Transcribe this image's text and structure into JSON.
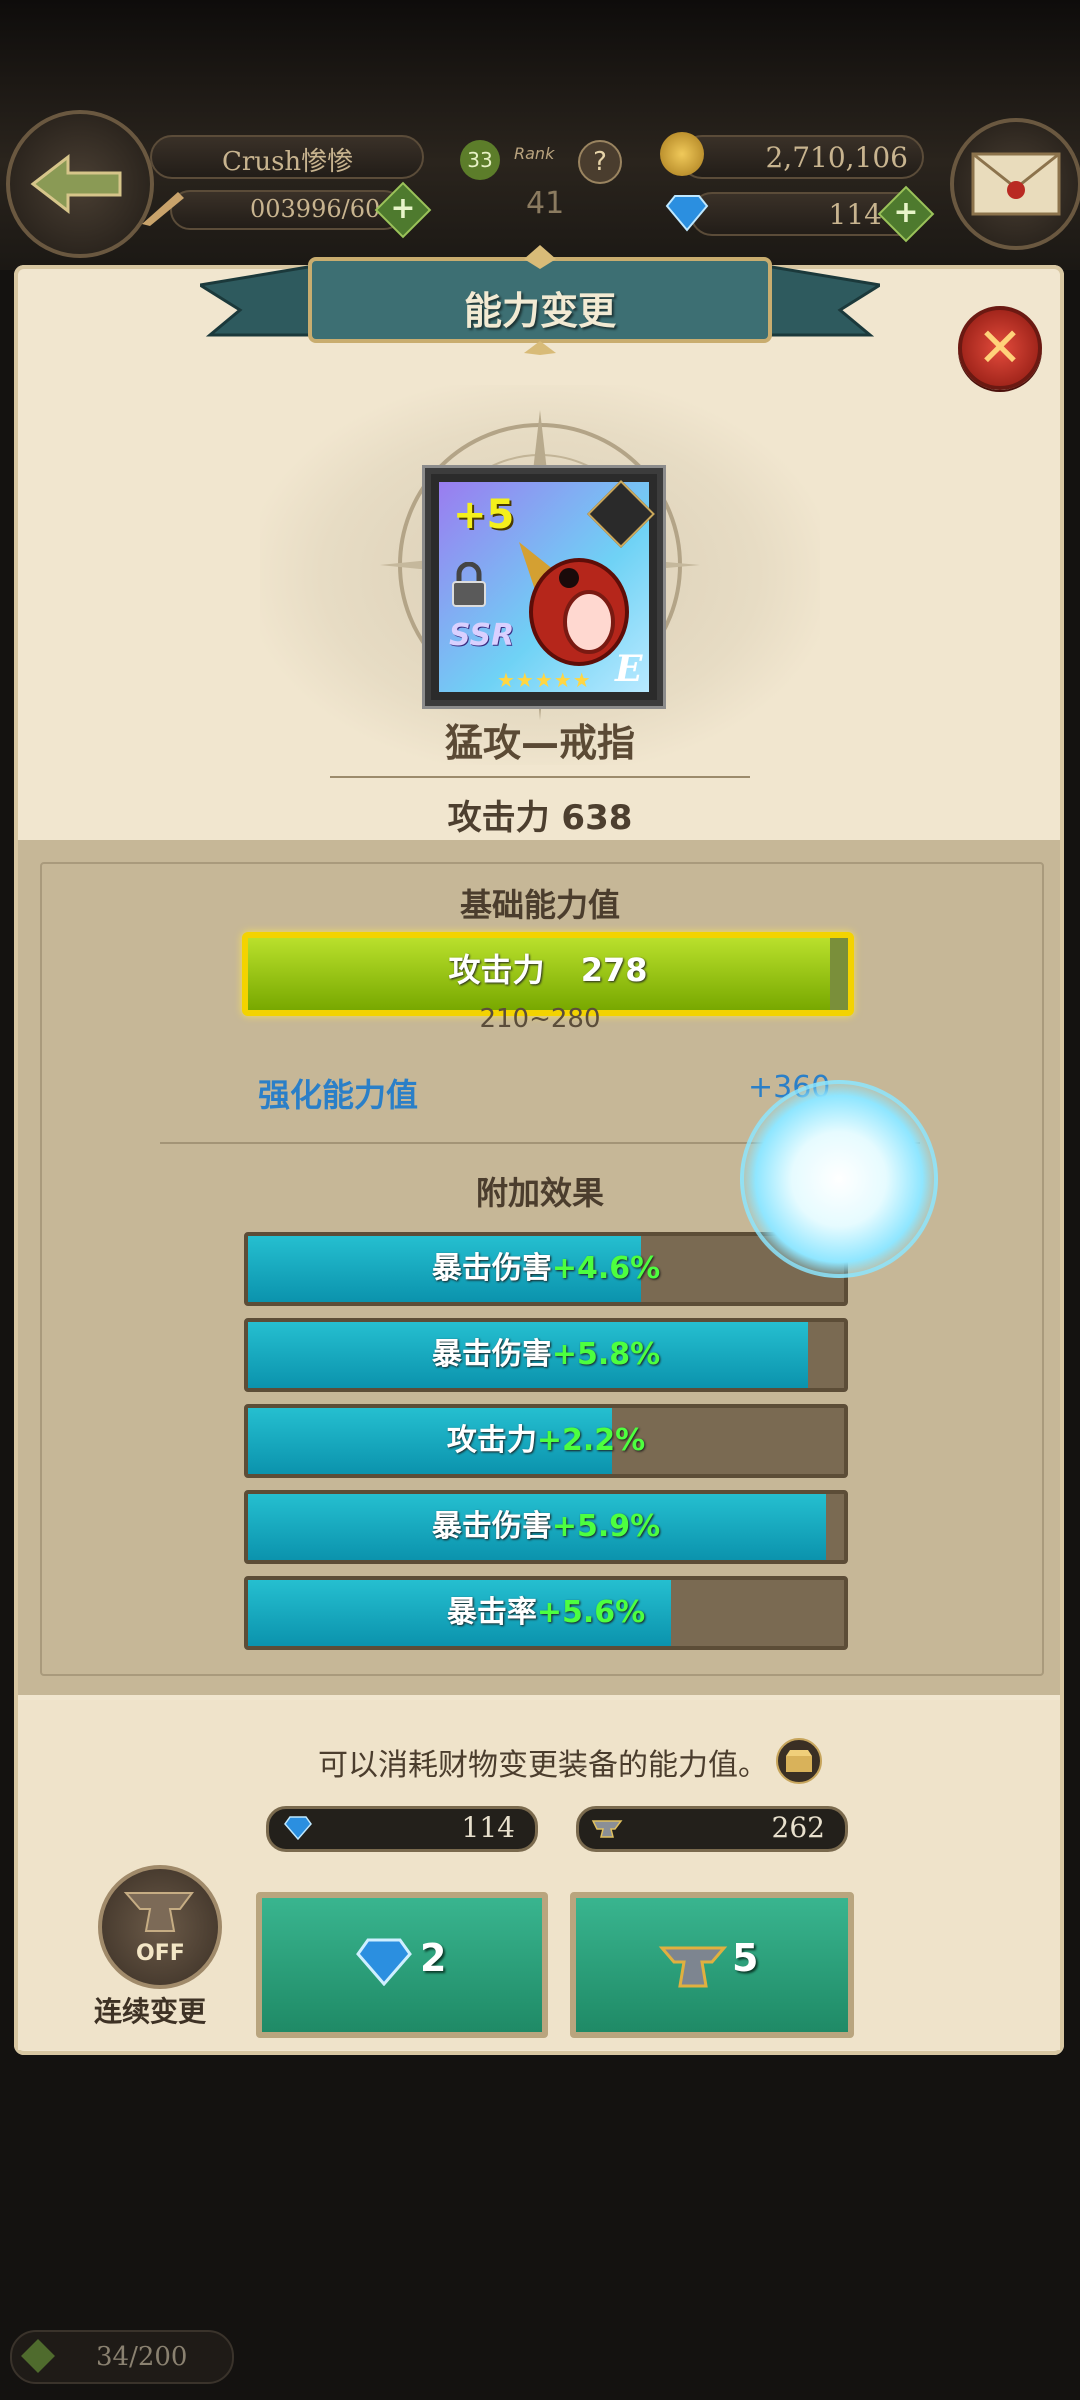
{
  "hud": {
    "player_name": "Crush惨惨",
    "level": "33",
    "rank_label": "Rank",
    "rank_value": "41",
    "help_mark": "?",
    "stamina": "003996/60",
    "gold": "2,710,106",
    "gems": "114"
  },
  "dialog": {
    "title": "能力变更",
    "close_label": "✕",
    "item": {
      "name": "猛攻—戒指",
      "enhance_level": "+5",
      "rarity": "SSR",
      "stars": "★★★★★",
      "grade": "E",
      "attack_summary": "攻击力 638"
    },
    "base_section": {
      "title": "基础能力值",
      "stat_label": "攻击力",
      "stat_value": "278",
      "range": "210~280",
      "fill_fraction": 0.97
    },
    "enhance_section": {
      "label": "强化能力值",
      "value": "+360"
    },
    "effects_section": {
      "title": "附加效果",
      "effects": [
        {
          "label": "暴击伤害",
          "value": "+4.6%",
          "fill_fraction": 0.66
        },
        {
          "label": "暴击伤害",
          "value": "+5.8%",
          "fill_fraction": 0.94
        },
        {
          "label": "攻击力",
          "value": "+2.2%",
          "fill_fraction": 0.61
        },
        {
          "label": "暴击伤害",
          "value": "+5.9%",
          "fill_fraction": 0.97
        },
        {
          "label": "暴击率",
          "value": "+5.6%",
          "fill_fraction": 0.71
        }
      ]
    },
    "footer": {
      "info_text": "可以消耗财物变更装备的能力值。",
      "gem_count": "114",
      "anvil_count": "262",
      "gem_cost": "2",
      "anvil_cost": "5",
      "auto_toggle_state": "OFF",
      "auto_toggle_label": "连续变更"
    }
  },
  "bottom": {
    "counter": "34/200"
  },
  "colors": {
    "parchment": "#f1e6cf",
    "effect_fill": "#13a7bd",
    "effect_value": "#4dff3f",
    "enhance_blue": "#2a7fc8",
    "base_fill": "#8ab500"
  }
}
